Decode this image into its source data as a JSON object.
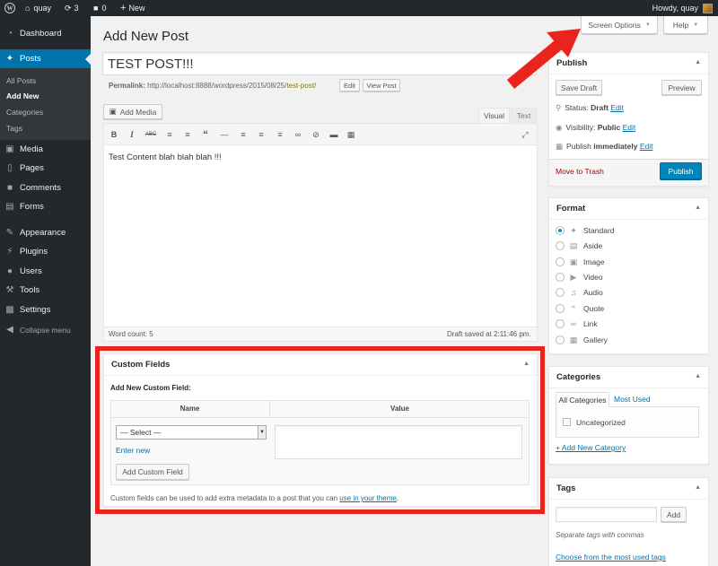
{
  "adminbar": {
    "site_name": "quay",
    "updates_count": "3",
    "comments_count": "0",
    "new_label": "New",
    "greeting": "Howdy, quay"
  },
  "sidebar": {
    "items": [
      {
        "label": "Dashboard",
        "icon": "dashboard-icon"
      },
      {
        "label": "Posts",
        "icon": "pin-icon"
      },
      {
        "label": "Media",
        "icon": "media-icon"
      },
      {
        "label": "Pages",
        "icon": "pages-icon"
      },
      {
        "label": "Comments",
        "icon": "comments-icon"
      },
      {
        "label": "Forms",
        "icon": "forms-icon"
      },
      {
        "label": "Appearance",
        "icon": "appearance-icon"
      },
      {
        "label": "Plugins",
        "icon": "plugins-icon"
      },
      {
        "label": "Users",
        "icon": "users-icon"
      },
      {
        "label": "Tools",
        "icon": "tools-icon"
      },
      {
        "label": "Settings",
        "icon": "settings-icon"
      }
    ],
    "posts_submenu": [
      "All Posts",
      "Add New",
      "Categories",
      "Tags"
    ],
    "collapse_label": "Collapse menu"
  },
  "screen_options": {
    "label": "Screen Options",
    "help": "Help"
  },
  "page_title": "Add New Post",
  "post": {
    "title": "TEST POST!!!",
    "permalink_label": "Permalink:",
    "permalink_base": "http://localhost:8888/wordpress/2015/08/25/",
    "permalink_slug": "test-post",
    "permalink_trailing": "/",
    "edit_btn": "Edit",
    "view_btn": "View Post"
  },
  "editor": {
    "add_media": "Add Media",
    "tab_visual": "Visual",
    "tab_text": "Text",
    "content": "Test Content blah blah blah !!!",
    "word_count": "Word count: 5",
    "draft_saved": "Draft saved at 2:11:46 pm."
  },
  "custom_fields": {
    "title": "Custom Fields",
    "add_new_label": "Add New Custom Field:",
    "col_name": "Name",
    "col_value": "Value",
    "select_value": "— Select —",
    "enter_new": "Enter new",
    "add_button": "Add Custom Field",
    "help_text": "Custom fields can be used to add extra metadata to a post that you can",
    "help_link": "use in your theme",
    "help_end": "."
  },
  "publish": {
    "title": "Publish",
    "save_draft": "Save Draft",
    "preview": "Preview",
    "status_label": "Status:",
    "status_value": "Draft",
    "visibility_label": "Visibility:",
    "visibility_value": "Public",
    "publish_label": "Publish",
    "publish_value": "immediately",
    "edit": "Edit",
    "trash": "Move to Trash",
    "publish_btn": "Publish"
  },
  "format": {
    "title": "Format",
    "options": [
      {
        "label": "Standard",
        "icon": "pin-icon",
        "selected": true
      },
      {
        "label": "Aside",
        "icon": "aside-icon",
        "selected": false
      },
      {
        "label": "Image",
        "icon": "image-icon",
        "selected": false
      },
      {
        "label": "Video",
        "icon": "video-icon",
        "selected": false
      },
      {
        "label": "Audio",
        "icon": "audio-icon",
        "selected": false
      },
      {
        "label": "Quote",
        "icon": "quote-icon",
        "selected": false
      },
      {
        "label": "Link",
        "icon": "link-icon",
        "selected": false
      },
      {
        "label": "Gallery",
        "icon": "gallery-icon",
        "selected": false
      }
    ]
  },
  "categories": {
    "title": "Categories",
    "tab_all": "All Categories",
    "tab_used": "Most Used",
    "item": "Uncategorized",
    "add_new": "+ Add New Category"
  },
  "tags": {
    "title": "Tags",
    "add_btn": "Add",
    "hint": "Separate tags with commas",
    "choose": "Choose from the most used tags"
  },
  "colors": {
    "admin_dark": "#23282d",
    "accent": "#0073aa",
    "highlight_red": "#e8241c",
    "trash_red": "#a00"
  }
}
